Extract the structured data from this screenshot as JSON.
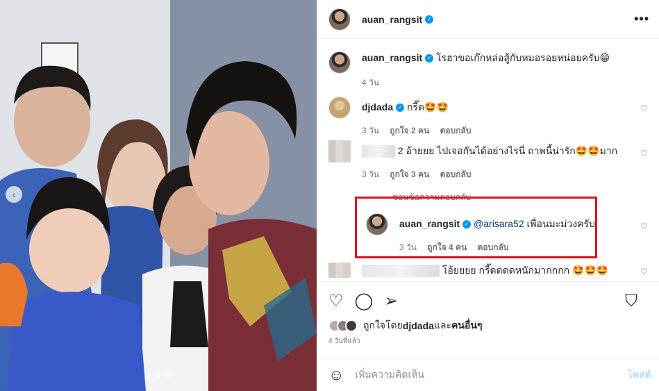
{
  "post": {
    "username": "auan_rangsit",
    "more_icon": "•••",
    "caption_user": "auan_rangsit",
    "caption_text": "โรฮาขอเก๊กหล่อสู้กับหมอรอยหน่อยครับ😁",
    "caption_time": "4 วัน"
  },
  "comments": [
    {
      "user": "djdada",
      "text": "กรี๊ด🤩🤩",
      "time": "3 วัน",
      "likes": "ถูกใจ 2 คน",
      "reply": "ตอบกลับ"
    },
    {
      "user": "",
      "text": "2 อ้ายยย ไปเจอกันได้อย่างไรนี่ ถาพนี้น่ารัก🤩🤩มาก",
      "time": "3 วัน",
      "likes": "ถูกใจ 3 คน",
      "reply": "ตอบกลับ"
    },
    {
      "user": "",
      "text": "โอ้ยยยย กรี๊ดดดดหนักมากกกก 🤩🤩🤩"
    }
  ],
  "hide_replies": "ซ่อนข้อความตอบกลับ",
  "reply": {
    "user": "auan_rangsit",
    "mention": "@arisara52",
    "text": " เพื่อนมะม่วงครับ",
    "time": "3 วัน",
    "likes": "ถูกใจ 4 คน",
    "reply": "ตอบกลับ"
  },
  "liked_by": {
    "prefix": "ถูกใจโดย ",
    "user": "djdada",
    "mid": " และ",
    "others": "คนอื่นๆ"
  },
  "post_date": "4 วันที่แล้ว",
  "add_comment": {
    "placeholder": "เพิ่มความคิดเห็น",
    "post": "โพสต์"
  },
  "colors": {
    "highlight": "#e5101c",
    "verified": "#0095f6",
    "link": "#00376b"
  },
  "carousel": {
    "slides": 3,
    "current": 1
  }
}
